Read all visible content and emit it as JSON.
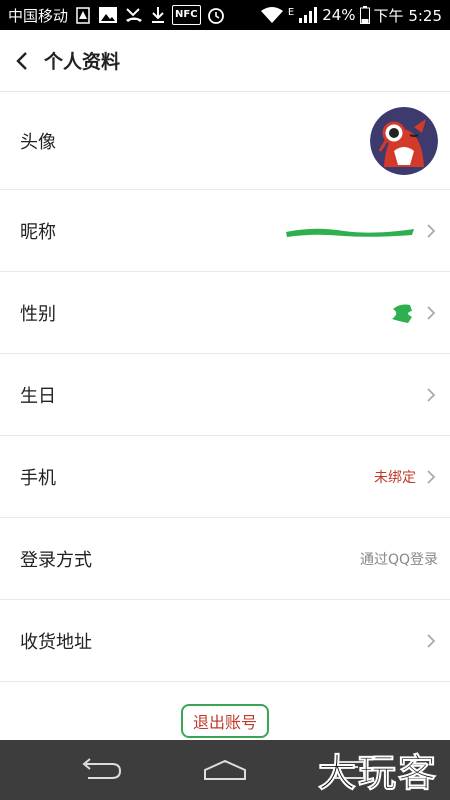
{
  "status_bar": {
    "carrier": "中国移动",
    "network": "E",
    "battery": "24%",
    "time": "下午 5:25",
    "nfc": "NFC",
    "icons": [
      "warning-icon",
      "image-icon",
      "missed-call-icon",
      "download-icon",
      "nfc-icon",
      "alarm-icon",
      "wifi-icon",
      "signal-icon",
      "battery-icon"
    ]
  },
  "header": {
    "title": "个人资料",
    "back_icon": "back-arrow-icon"
  },
  "rows": [
    {
      "label": "头像",
      "value": "",
      "kind": "avatar"
    },
    {
      "label": "昵称",
      "value": "",
      "kind": "redacted"
    },
    {
      "label": "性别",
      "value": "",
      "kind": "redacted-small"
    },
    {
      "label": "生日",
      "value": "",
      "kind": "plain"
    },
    {
      "label": "手机",
      "value": "未绑定",
      "kind": "red"
    },
    {
      "label": "登录方式",
      "value": "通过QQ登录",
      "kind": "nochev"
    },
    {
      "label": "收货地址",
      "value": "",
      "kind": "plain"
    }
  ],
  "logout_label": "退出账号",
  "nav": {
    "icons": [
      "back-nav-icon",
      "home-nav-icon",
      "recents-nav-icon"
    ]
  },
  "watermark": "大玩客",
  "colors": {
    "accent_red": "#c0392b",
    "redaction_green": "#2db04d",
    "nav_bg": "#3d3d3d"
  }
}
